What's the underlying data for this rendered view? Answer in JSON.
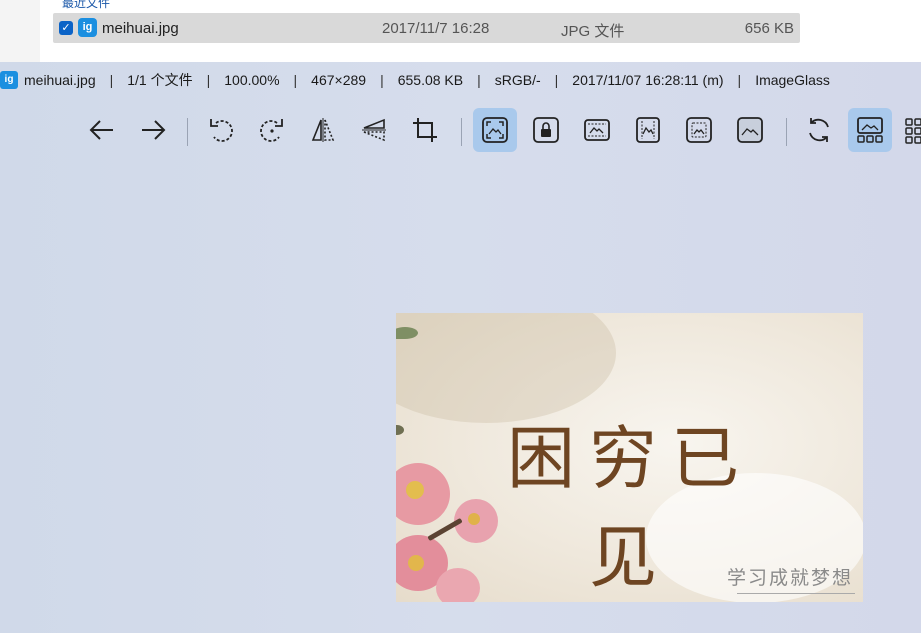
{
  "explorer": {
    "peek_text": "最近文件",
    "file": {
      "name": "meihuai.jpg",
      "date": "2017/11/7 16:28",
      "type": "JPG 文件",
      "size": "656 KB"
    }
  },
  "titlebar": {
    "filename": "meihuai.jpg",
    "index": "1/1 个文件",
    "zoom": "100.00%",
    "dimensions": "467×289",
    "filesize": "655.08 KB",
    "color_profile": "sRGB/-",
    "modified": "2017/11/07 16:28:11 (m)",
    "app_name": "ImageGlass",
    "separator": "|"
  },
  "toolbar": {
    "buttons": [
      {
        "icon": "arrow-left-icon"
      },
      {
        "icon": "arrow-right-icon"
      },
      {
        "icon": "rotate-left-icon"
      },
      {
        "icon": "rotate-right-icon"
      },
      {
        "icon": "flip-horizontal-icon"
      },
      {
        "icon": "flip-vertical-icon"
      },
      {
        "icon": "crop-icon"
      },
      {
        "icon": "auto-zoom-icon",
        "active": true
      },
      {
        "icon": "lock-zoom-icon"
      },
      {
        "icon": "scale-to-width-icon"
      },
      {
        "icon": "scale-to-height-icon"
      },
      {
        "icon": "scale-to-fit-icon"
      },
      {
        "icon": "scale-to-fill-icon"
      },
      {
        "icon": "refresh-icon"
      },
      {
        "icon": "thumbnail-bar-icon",
        "active": true
      },
      {
        "icon": "gallery-icon"
      }
    ]
  },
  "image": {
    "title_text": "困穷已见",
    "caption_text": "学习成就梦想"
  },
  "colors": {
    "accent": "#a9c9ec",
    "viewer_bg": "#d5ddea",
    "title_ink": "#6e4522"
  }
}
